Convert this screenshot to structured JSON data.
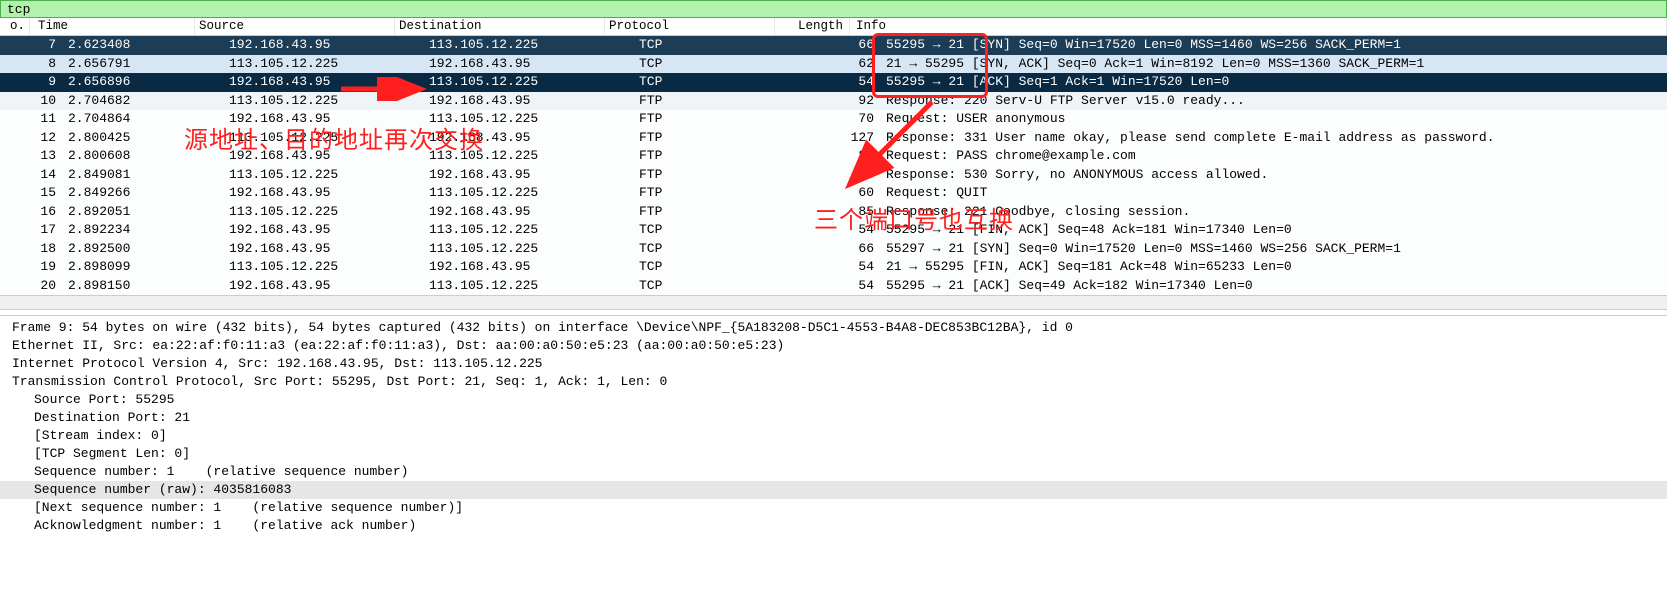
{
  "filter": {
    "text": "tcp"
  },
  "columns": {
    "no": "o.",
    "time": "Time",
    "source": "Source",
    "destination": "Destination",
    "protocol": "Protocol",
    "length": "Length",
    "info": "Info"
  },
  "packets": [
    {
      "no": "7",
      "time": "2.623408",
      "src": "192.168.43.95",
      "dst": "113.105.12.225",
      "proto": "TCP",
      "len": "66",
      "info": "55295 → 21 [SYN] Seq=0 Win=17520 Len=0 MSS=1460 WS=256 SACK_PERM=1",
      "cls": "dark"
    },
    {
      "no": "8",
      "time": "2.656791",
      "src": "113.105.12.225",
      "dst": "192.168.43.95",
      "proto": "TCP",
      "len": "62",
      "info": "21 → 55295 [SYN, ACK] Seq=0 Ack=1 Win=8192 Len=0 MSS=1360 SACK_PERM=1",
      "cls": "sel-soft"
    },
    {
      "no": "9",
      "time": "2.656896",
      "src": "192.168.43.95",
      "dst": "113.105.12.225",
      "proto": "TCP",
      "len": "54",
      "info": "55295 → 21 [ACK] Seq=1 Ack=1 Win=17520 Len=0",
      "cls": "sel-hard"
    },
    {
      "no": "10",
      "time": "2.704682",
      "src": "113.105.12.225",
      "dst": "192.168.43.95",
      "proto": "FTP",
      "len": "92",
      "info": "Response: 220 Serv-U FTP Server v15.0 ready...",
      "cls": "alt"
    },
    {
      "no": "11",
      "time": "2.704864",
      "src": "192.168.43.95",
      "dst": "113.105.12.225",
      "proto": "FTP",
      "len": "70",
      "info": "Request: USER anonymous",
      "cls": "light"
    },
    {
      "no": "12",
      "time": "2.800425",
      "src": "113.105.12.225",
      "dst": "192.168.43.95",
      "proto": "FTP",
      "len": "127",
      "info": "Response: 331 User name okay, please send complete E-mail address as password.",
      "cls": "light"
    },
    {
      "no": "13",
      "time": "2.800608",
      "src": "192.168.43.95",
      "dst": "113.105.12.225",
      "proto": "FTP",
      "len": "89",
      "info": "Request: PASS chrome@example.com",
      "cls": "light"
    },
    {
      "no": "14",
      "time": "2.849081",
      "src": "113.105.12.225",
      "dst": "192.168.43.95",
      "proto": "FTP",
      "len": "95",
      "info": "Response: 530 Sorry, no ANONYMOUS access allowed.",
      "cls": "light"
    },
    {
      "no": "15",
      "time": "2.849266",
      "src": "192.168.43.95",
      "dst": "113.105.12.225",
      "proto": "FTP",
      "len": "60",
      "info": "Request: QUIT",
      "cls": "light"
    },
    {
      "no": "16",
      "time": "2.892051",
      "src": "113.105.12.225",
      "dst": "192.168.43.95",
      "proto": "FTP",
      "len": "85",
      "info": "Response: 221 Goodbye, closing session.",
      "cls": "light"
    },
    {
      "no": "17",
      "time": "2.892234",
      "src": "192.168.43.95",
      "dst": "113.105.12.225",
      "proto": "TCP",
      "len": "54",
      "info": "55295 → 21 [FIN, ACK] Seq=48 Ack=181 Win=17340 Len=0",
      "cls": "light"
    },
    {
      "no": "18",
      "time": "2.892500",
      "src": "192.168.43.95",
      "dst": "113.105.12.225",
      "proto": "TCP",
      "len": "66",
      "info": "55297 → 21 [SYN] Seq=0 Win=17520 Len=0 MSS=1460 WS=256 SACK_PERM=1",
      "cls": "light"
    },
    {
      "no": "19",
      "time": "2.898099",
      "src": "113.105.12.225",
      "dst": "192.168.43.95",
      "proto": "TCP",
      "len": "54",
      "info": "21 → 55295 [FIN, ACK] Seq=181 Ack=48 Win=65233 Len=0",
      "cls": "light"
    },
    {
      "no": "20",
      "time": "2.898150",
      "src": "192.168.43.95",
      "dst": "113.105.12.225",
      "proto": "TCP",
      "len": "54",
      "info": "55295 → 21 [ACK] Seq=49 Ack=182 Win=17340 Len=0",
      "cls": "light"
    }
  ],
  "details": {
    "frame": "Frame 9: 54 bytes on wire (432 bits), 54 bytes captured (432 bits) on interface \\Device\\NPF_{5A183208-D5C1-4553-B4A8-DEC853BC12BA}, id 0",
    "eth": "Ethernet II, Src: ea:22:af:f0:11:a3 (ea:22:af:f0:11:a3), Dst: aa:00:a0:50:e5:23 (aa:00:a0:50:e5:23)",
    "ip": "Internet Protocol Version 4, Src: 192.168.43.95, Dst: 113.105.12.225",
    "tcp": "Transmission Control Protocol, Src Port: 55295, Dst Port: 21, Seq: 1, Ack: 1, Len: 0",
    "src_port": "Source Port: 55295",
    "dst_port": "Destination Port: 21",
    "stream": "[Stream index: 0]",
    "seglen": "[TCP Segment Len: 0]",
    "seq": "Sequence number: 1    (relative sequence number)",
    "seq_raw": "Sequence number (raw): 4035816083",
    "next_seq": "[Next sequence number: 1    (relative sequence number)]",
    "ack": "Acknowledgment number: 1    (relative ack number)"
  },
  "annotations": {
    "text1": "源地址、目的地址再次交换",
    "text2": "三个端口号也互换"
  }
}
